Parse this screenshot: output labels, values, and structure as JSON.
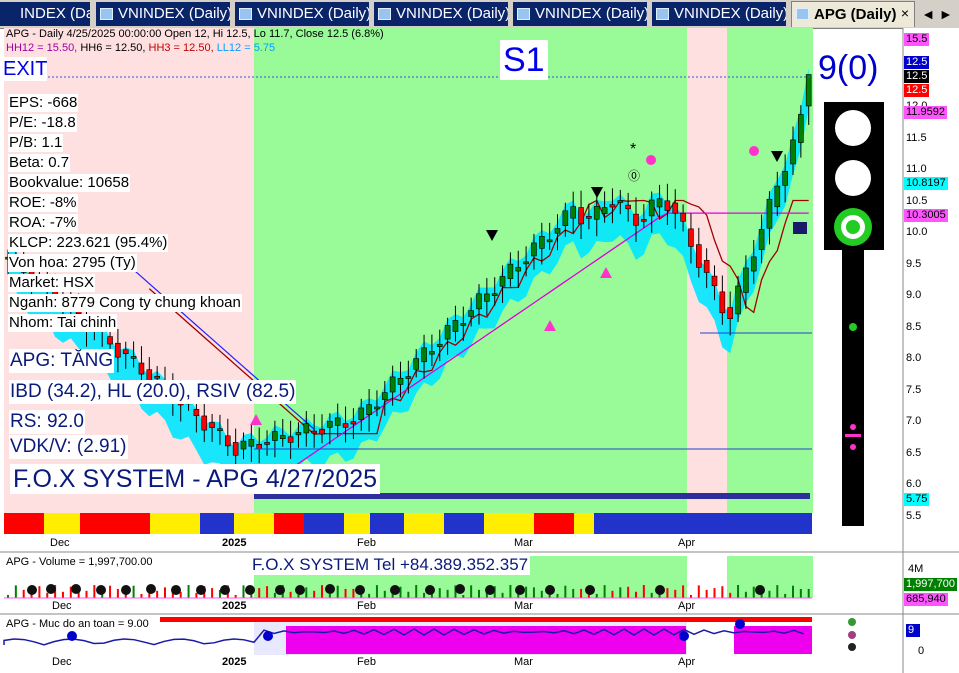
{
  "tabs": [
    {
      "label": "INDEX (Daily)"
    },
    {
      "label": "VNINDEX (Daily)"
    },
    {
      "label": "VNINDEX (Daily)"
    },
    {
      "label": "VNINDEX (Daily)"
    },
    {
      "label": "VNINDEX (Daily)"
    },
    {
      "label": "VNINDEX (Daily)"
    },
    {
      "label": "APG (Daily)"
    }
  ],
  "tab_close": "×",
  "tab_scroll": "◄ ►",
  "header": {
    "line1": "APG - Daily 4/25/2025 00:00:00 Open 12, Hi 12.5, Lo 11.7, Close 12.5 (6.8%)",
    "hh12": "HH12 = 15.50,",
    "hh6": "HH6 = 12.50,",
    "hh3": "HH3 = 12.50,",
    "ll12": "LL12 = 5.75"
  },
  "labels": {
    "exit": "EXIT",
    "s1": "S1",
    "signal": "9(0)",
    "apg_status": "APG: TĂNG",
    "ibd": "IBD (34.2), HL (20.0), RSIV (82.5)",
    "rs": "RS: 92.0",
    "vdk": "VDK/V:  (2.91)",
    "fox_title": "F.O.X SYSTEM - APG 4/27/2025",
    "fox_tel": "F.O.X SYSTEM Tel +84.389.352.357"
  },
  "stats": [
    {
      "text": "EPS: -668"
    },
    {
      "text": "P/E: -18.8"
    },
    {
      "text": "P/B: 1.1"
    },
    {
      "text": "Beta: 0.7"
    },
    {
      "text": "Bookvalue: 10658"
    },
    {
      "text": "ROE: -8%"
    },
    {
      "text": "ROA: -7%"
    },
    {
      "text": "KLCP: 223.621 (95.4%)"
    },
    {
      "text": "Von hoa: 2795 (Ty)"
    },
    {
      "text": "Market: HSX"
    },
    {
      "text": "Nganh: 8779 Cong ty chung khoan"
    },
    {
      "text": "Nhom: Tai chinh"
    }
  ],
  "price_axis": {
    "ticks": [
      "12.0",
      "11.5",
      "11.0",
      "10.5",
      "10.0",
      "9.5",
      "9.0",
      "8.5",
      "8.0",
      "7.5",
      "7.0",
      "6.5",
      "6.0",
      "5.5"
    ],
    "markers": [
      {
        "text": "15.5",
        "bg": "#ff55ff",
        "fg": "#000000"
      },
      {
        "text": "12.5",
        "bg": "#0000cc",
        "fg": "#ffffff"
      },
      {
        "text": "12.5",
        "bg": "#000000",
        "fg": "#ffffff"
      },
      {
        "text": "12.5",
        "bg": "#ff0000",
        "fg": "#ffffff"
      },
      {
        "text": "11.9592",
        "bg": "#ff55ff",
        "fg": "#000000"
      },
      {
        "text": "10.8197",
        "bg": "#00ffff",
        "fg": "#000000"
      },
      {
        "text": "10.3005",
        "bg": "#ff55ff",
        "fg": "#000000"
      },
      {
        "text": "5.75",
        "bg": "#00ffff",
        "fg": "#000000"
      }
    ]
  },
  "date_axis": [
    {
      "label": "Dec"
    },
    {
      "label": "2025"
    },
    {
      "label": "Feb"
    },
    {
      "label": "Mar"
    },
    {
      "label": "Apr"
    }
  ],
  "volume_panel": {
    "title": "APG - Volume = 1,997,700.00",
    "axis_label": "4M",
    "tag_current": "1,997,700",
    "tag_avg": "685,940",
    "date_labels": [
      "Dec",
      "2025",
      "Feb",
      "Mar",
      "Apr"
    ]
  },
  "safety_panel": {
    "title": "APG - Muc do an toan = 9.00",
    "tag": "9",
    "axis_zero": "0",
    "date_labels": [
      "Dec",
      "2025",
      "Feb",
      "Mar",
      "Apr"
    ]
  },
  "colors": {
    "green_zone": "#98fb98",
    "pink_zone": "#ffe0e0",
    "band_cyan": "#00e5ff",
    "band_gray": "#b8b8b8",
    "up_candle": "#008000",
    "down_candle": "#ff0000",
    "brown_line": "#a00000",
    "magenta_line": "#dd00dd",
    "blue_line": "#2222ff",
    "dark_blue_bar": "#2e2e9c"
  }
}
